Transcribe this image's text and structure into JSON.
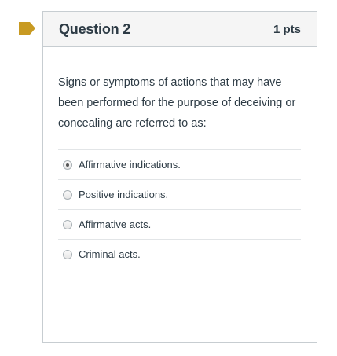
{
  "question": {
    "title": "Question 2",
    "points": "1 pts",
    "text": "Signs or symptoms of actions that may have been performed for the purpose of deceiving or concealing are referred to as:",
    "answers": [
      {
        "label": "Affirmative indications.",
        "selected": true
      },
      {
        "label": "Positive indications.",
        "selected": false
      },
      {
        "label": "Affirmative acts.",
        "selected": false
      },
      {
        "label": "Criminal acts.",
        "selected": false
      }
    ]
  },
  "colors": {
    "flag": "#c89a22",
    "border": "#c7cdd1",
    "header_bg": "#f5f5f5",
    "text": "#2d3b45"
  },
  "icons": {
    "flag": "bookmark-flag-icon"
  }
}
